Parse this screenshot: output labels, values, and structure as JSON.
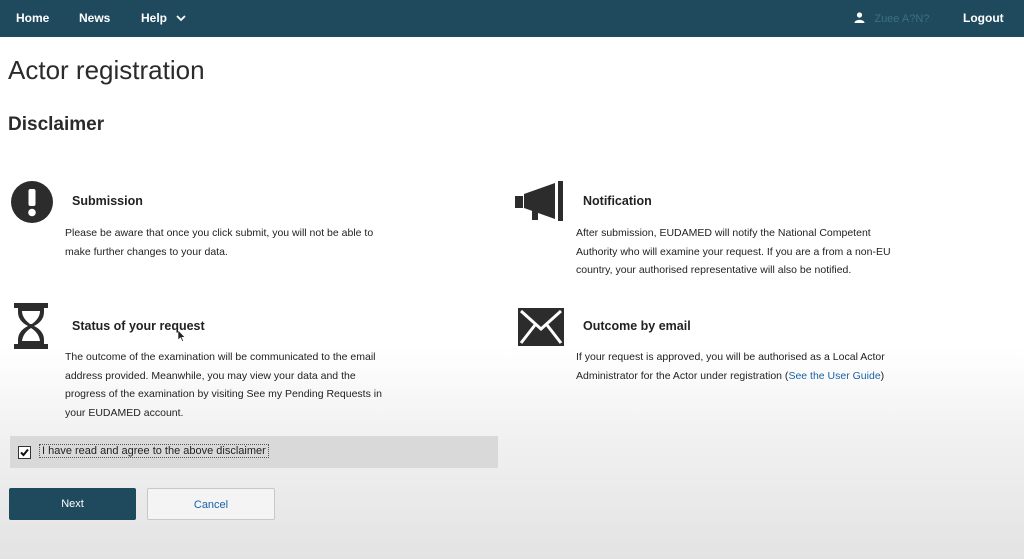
{
  "nav": {
    "home": "Home",
    "news": "News",
    "help": "Help",
    "user": "Zuee A?N?",
    "logout": "Logout"
  },
  "page": {
    "title": "Actor registration",
    "section": "Disclaimer"
  },
  "blocks": {
    "submission": {
      "title": "Submission",
      "lines": [
        "Please be aware that once you click submit, you will not be able to",
        "make further changes to your data."
      ]
    },
    "notification": {
      "title": "Notification",
      "lines": [
        "After submission, EUDAMED will notify the National Competent",
        "Authority who will examine your request. If you are a from a non-EU",
        "country, your authorised representative will also be notified."
      ]
    },
    "status": {
      "title": "Status of your request",
      "lines": [
        "The outcome of the examination will be communicated to the email",
        "address provided. Meanwhile, you may view your data and the",
        "progress of the examination by visiting See my Pending Requests in",
        "your EUDAMED account."
      ]
    },
    "outcome": {
      "title": "Outcome by email",
      "line1": "If your request is approved, you will be authorised as a Local Actor",
      "line2_prefix": "Administrator for the Actor under registration (",
      "link": "See the User Guide",
      "line2_suffix": ")"
    }
  },
  "consent": {
    "label": "I have read and agree to the above disclaimer",
    "checked": true
  },
  "buttons": {
    "next": "Next",
    "cancel": "Cancel"
  },
  "colors": {
    "navbar": "#1f4a5e",
    "primary_button": "#1f4a5e",
    "link": "#1a62a8",
    "consent_bar": "#d9d9d9"
  },
  "icons": {
    "submission": "exclamation-circle-icon",
    "notification": "megaphone-icon",
    "status": "hourglass-icon",
    "outcome": "envelope-icon",
    "user": "user-icon",
    "help": "chevron-down-icon"
  }
}
